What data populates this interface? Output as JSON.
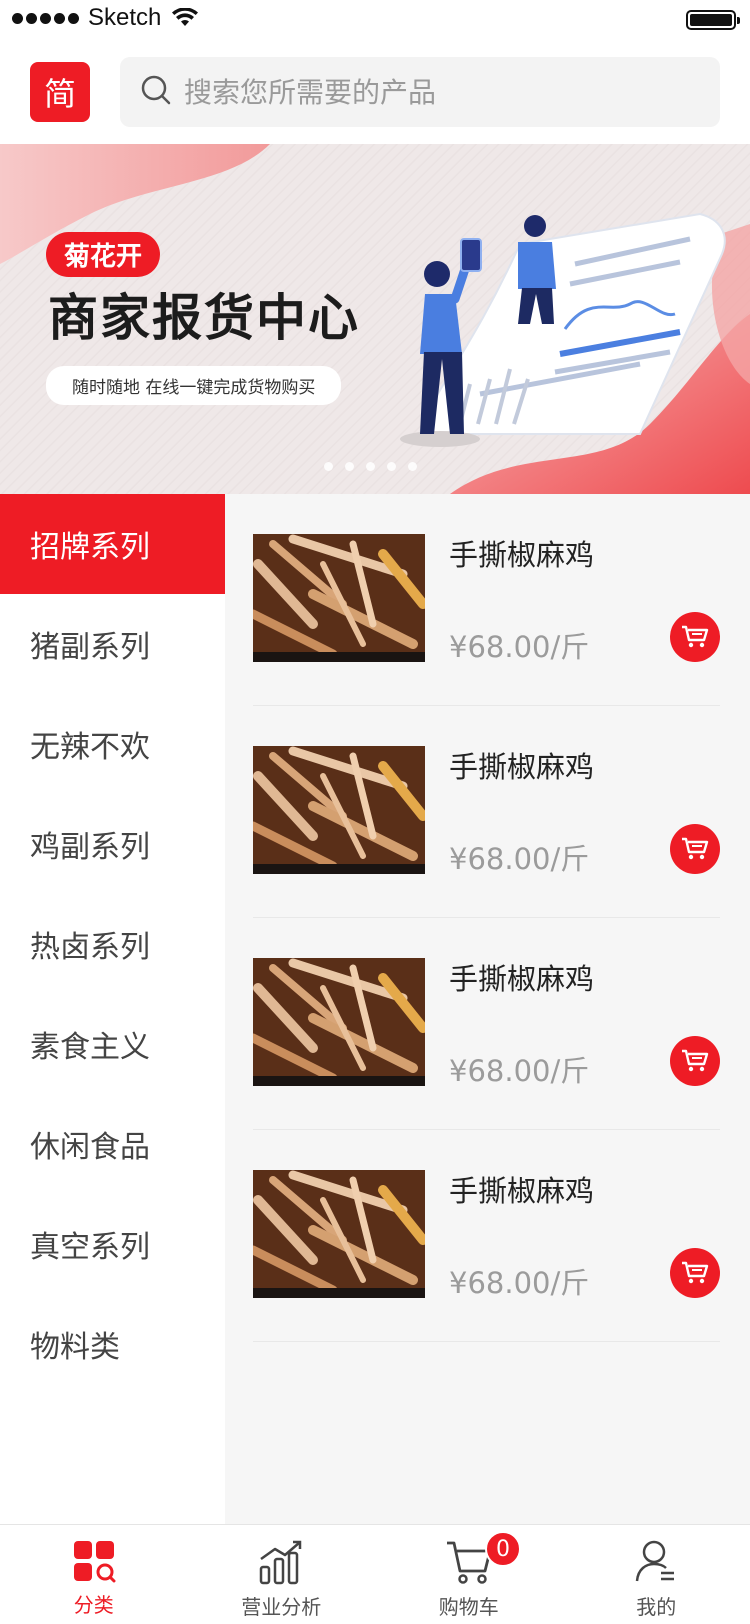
{
  "status_bar": {
    "carrier": "Sketch"
  },
  "header": {
    "logo_text": "简",
    "search_placeholder": "搜索您所需要的产品"
  },
  "banner": {
    "badge": "菊花开",
    "title": "商家报货中心",
    "subtitle": "随时随地 在线一键完成货物购买",
    "page_count": 5,
    "active_page": 1
  },
  "categories": [
    {
      "label": "招牌系列",
      "active": true
    },
    {
      "label": "猪副系列",
      "active": false
    },
    {
      "label": "无辣不欢",
      "active": false
    },
    {
      "label": "鸡副系列",
      "active": false
    },
    {
      "label": "热卤系列",
      "active": false
    },
    {
      "label": "素食主义",
      "active": false
    },
    {
      "label": "休闲食品",
      "active": false
    },
    {
      "label": "真空系列",
      "active": false
    },
    {
      "label": "物料类",
      "active": false
    }
  ],
  "products": [
    {
      "name": "手撕椒麻鸡",
      "price": "¥68.00/斤"
    },
    {
      "name": "手撕椒麻鸡",
      "price": "¥68.00/斤"
    },
    {
      "name": "手撕椒麻鸡",
      "price": "¥68.00/斤"
    },
    {
      "name": "手撕椒麻鸡",
      "price": "¥68.00/斤"
    }
  ],
  "tabbar": {
    "tabs": [
      {
        "label": "分类",
        "icon": "category-icon",
        "active": true
      },
      {
        "label": "营业分析",
        "icon": "analytics-icon",
        "active": false
      },
      {
        "label": "购物车",
        "icon": "cart-icon",
        "active": false
      },
      {
        "label": "我的",
        "icon": "profile-icon",
        "active": false
      }
    ],
    "cart_count": "0"
  },
  "colors": {
    "accent": "#ee1c25",
    "sidebar_bg": "#ffffff",
    "list_bg": "#f6f6f6"
  }
}
